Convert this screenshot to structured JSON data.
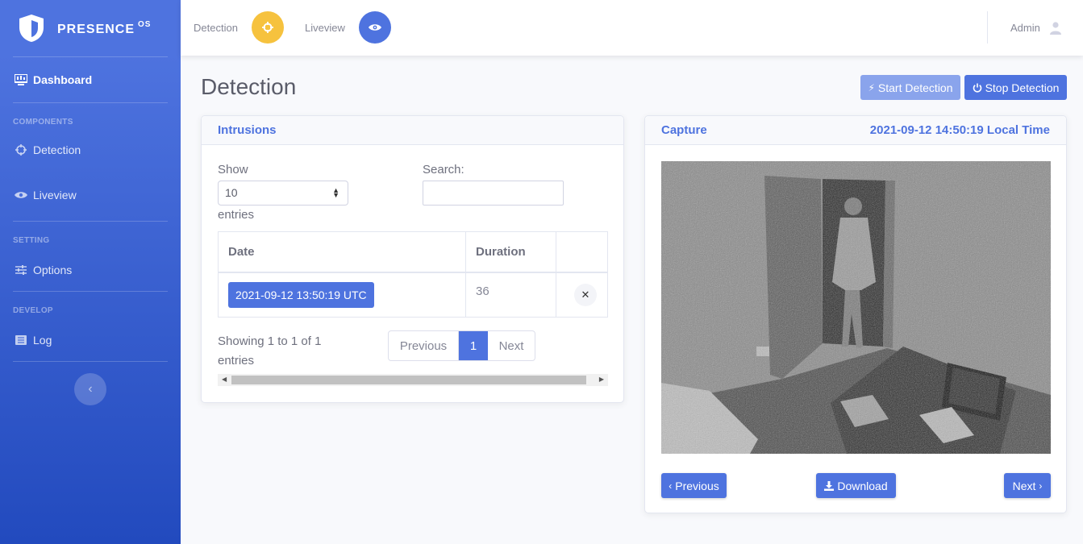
{
  "brand": {
    "name": "PRESENCE",
    "suffix": "OS"
  },
  "sidebar": {
    "dashboard": "Dashboard",
    "headings": {
      "components": "COMPONENTS",
      "setting": "SETTING",
      "develop": "DEVELOP"
    },
    "items": {
      "detection": "Detection",
      "liveview": "Liveview",
      "options": "Options",
      "log": "Log"
    }
  },
  "topbar": {
    "detection": "Detection",
    "liveview": "Liveview",
    "user": "Admin",
    "colors": {
      "detection": "#f6c23e",
      "liveview": "#4e73df"
    }
  },
  "page": {
    "title": "Detection",
    "start_btn": "Start Detection",
    "stop_btn": "Stop Detection"
  },
  "intrusions": {
    "title": "Intrusions",
    "show_label": "Show",
    "page_size": "10",
    "entries_label": "entries",
    "search_label": "Search:",
    "search_value": "",
    "columns": [
      "Date",
      "Duration"
    ],
    "rows": [
      {
        "date": "2021-09-12 13:50:19 UTC",
        "duration": "36"
      }
    ],
    "info_line1": "Showing 1 to 1 of 1",
    "info_line2": "entries",
    "pager": {
      "prev": "Previous",
      "current": "1",
      "next": "Next"
    }
  },
  "capture": {
    "title": "Capture",
    "timestamp": "2021-09-12 14:50:19 Local Time",
    "prev": "Previous",
    "download": "Download",
    "next": "Next"
  }
}
